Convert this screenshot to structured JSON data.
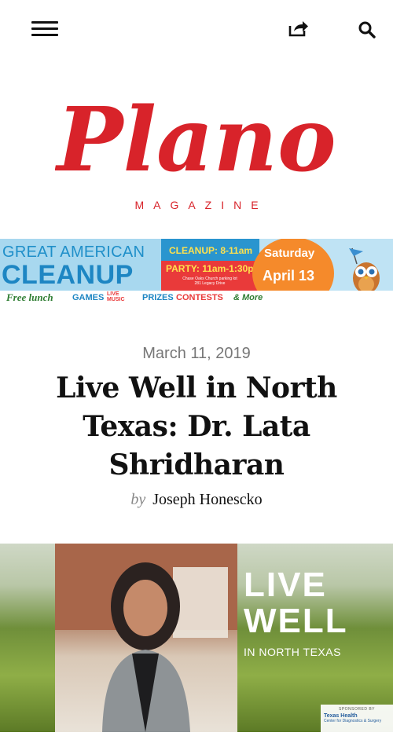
{
  "header": {
    "menu_icon": "hamburger-menu-icon",
    "share_icon": "share-icon",
    "search_icon": "search-icon"
  },
  "logo": {
    "wordmark": "Plano",
    "subtitle": "MAGAZINE",
    "color": "#d8232a"
  },
  "banner_ad": {
    "line1": "GREAT AMERICAN",
    "line2": "CLEANUP",
    "cleanup_time": "CLEANUP: 8-11am",
    "party_time": "PARTY: 11am-1:30pm",
    "location_line1": "Chase Oaks Church parking lot",
    "location_line2": "281 Legacy Drive",
    "day": "Saturday",
    "date": "April 13",
    "features": [
      "Free lunch",
      "GAMES",
      "LIVE MUSIC",
      "PRIZES",
      "CONTESTS",
      "& More"
    ]
  },
  "article": {
    "date": "March 11, 2019",
    "title": "Live Well in North Texas: Dr. Lata Shridharan",
    "by_label": "by",
    "author": "Joseph Honescko"
  },
  "hero": {
    "headline_line1": "LIVE",
    "headline_line2": "WELL",
    "subline": "IN NORTH TEXAS",
    "sponsor_label": "SPONSORED BY",
    "sponsor_name": "Texas Health",
    "sponsor_sub": "Center for Diagnostics & Surgery"
  }
}
